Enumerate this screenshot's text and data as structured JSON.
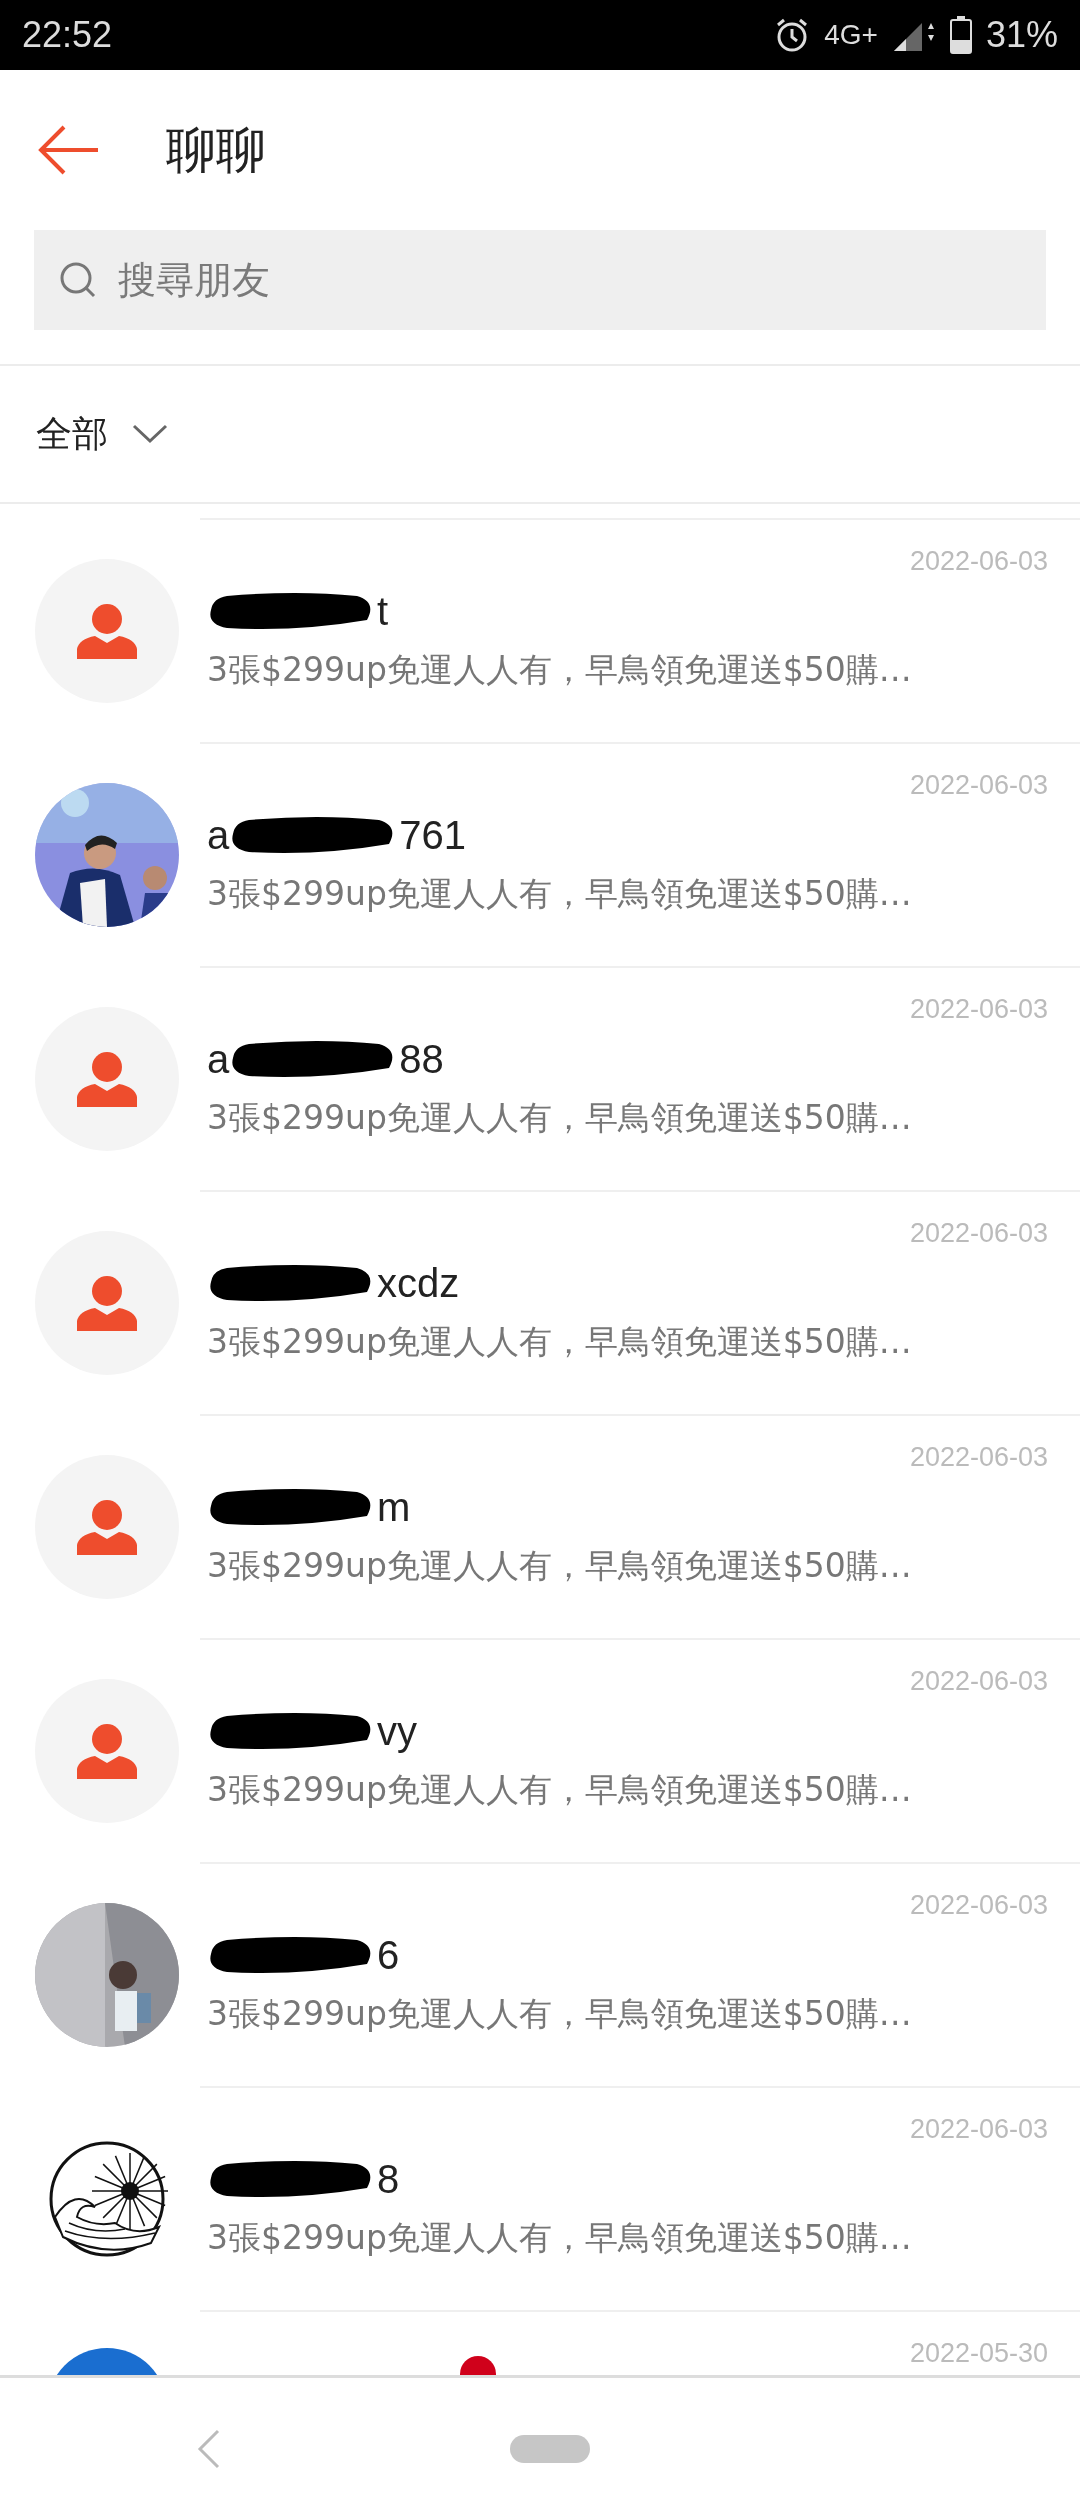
{
  "status_bar": {
    "time": "22:52",
    "network": "4G+",
    "battery": "31%"
  },
  "header": {
    "title": "聊聊"
  },
  "search": {
    "placeholder": "搜尋朋友"
  },
  "filter": {
    "label": "全部"
  },
  "chats": [
    {
      "kind": "default",
      "name_end": "t",
      "date": "2022-06-03",
      "message": "3張$299up免運人人有，早鳥領免運送$50購…"
    },
    {
      "kind": "picture",
      "name_start": "a",
      "name_end": "761",
      "date": "2022-06-03",
      "message": "3張$299up免運人人有，早鳥領免運送$50購…"
    },
    {
      "kind": "default",
      "name_start": "a",
      "name_end": "88",
      "date": "2022-06-03",
      "message": "3張$299up免運人人有，早鳥領免運送$50購…"
    },
    {
      "kind": "default",
      "name_end": "xcdz",
      "date": "2022-06-03",
      "message": "3張$299up免運人人有，早鳥領免運送$50購…"
    },
    {
      "kind": "default",
      "name_end": "m",
      "date": "2022-06-03",
      "message": "3張$299up免運人人有，早鳥領免運送$50購…"
    },
    {
      "kind": "default",
      "name_end": "vy",
      "date": "2022-06-03",
      "message": "3張$299up免運人人有，早鳥領免運送$50購…"
    },
    {
      "kind": "picture",
      "name_end": "6",
      "date": "2022-06-03",
      "message": "3張$299up免運人人有，早鳥領免運送$50購…"
    },
    {
      "kind": "logo",
      "name_end": "8",
      "date": "2022-06-03",
      "message": "3張$299up免運人人有，早鳥領免運送$50購…"
    },
    {
      "kind": "plain",
      "date": "2022-05-30",
      "unread": true
    }
  ]
}
